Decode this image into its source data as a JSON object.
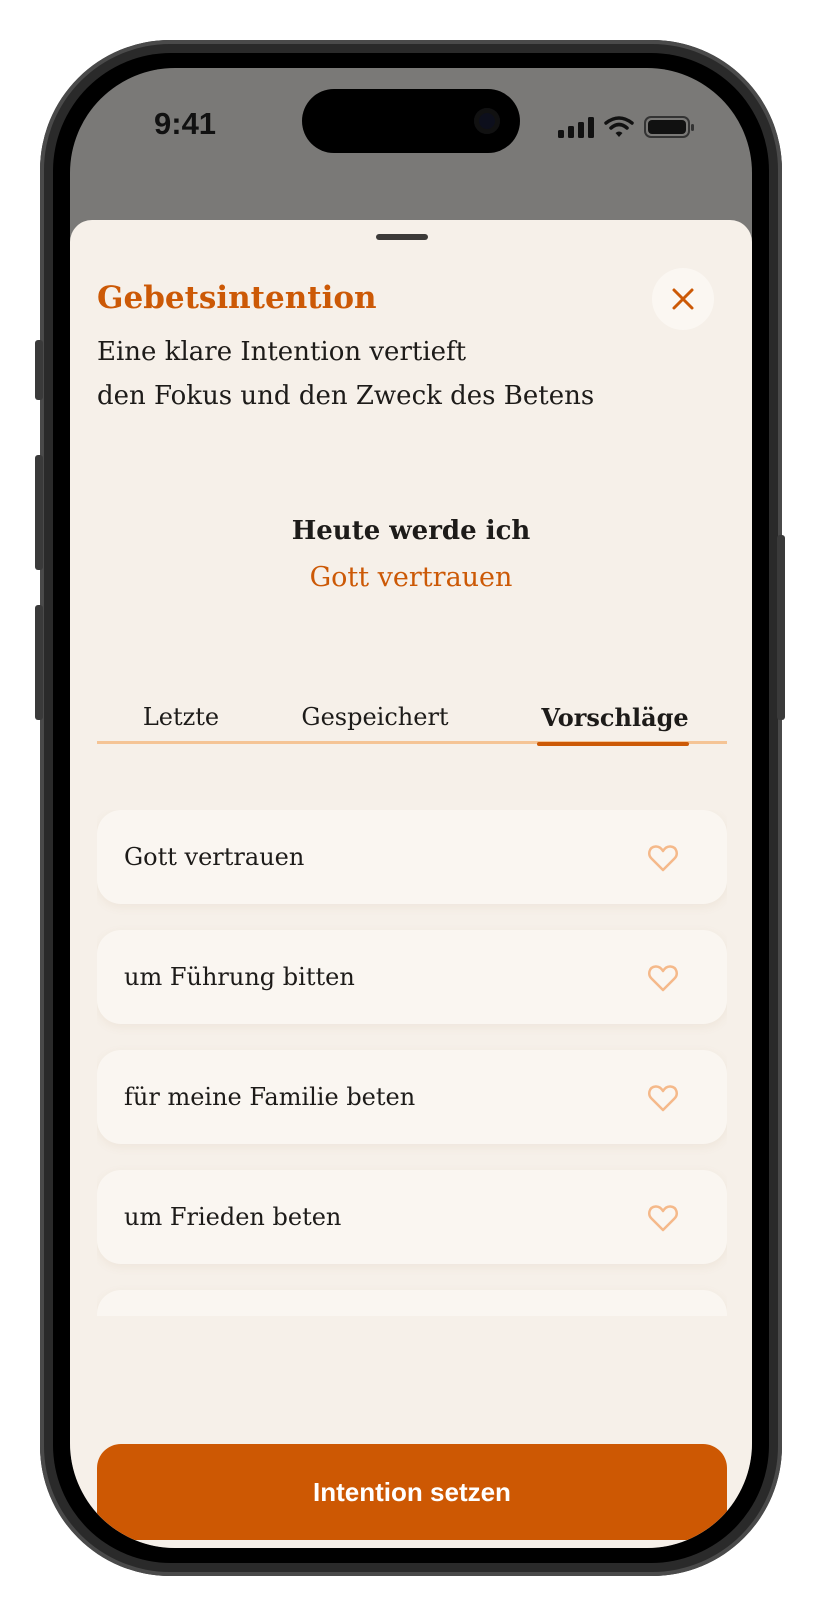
{
  "status_bar": {
    "time": "9:41",
    "icons": [
      "signal-icon",
      "wifi-icon",
      "battery-icon"
    ]
  },
  "sheet": {
    "title": "Gebetsintention",
    "subtitle_line1": "Eine klare Intention vertieft",
    "subtitle_line2": "den Fokus und den Zweck des Betens",
    "close_icon": "close-icon"
  },
  "intention": {
    "label": "Heute werde ich",
    "value": "Gott vertrauen"
  },
  "tabs": [
    {
      "label": "Letzte",
      "active": false
    },
    {
      "label": "Gespeichert",
      "active": false
    },
    {
      "label": "Vorschläge",
      "active": true
    }
  ],
  "suggestions": [
    {
      "label": "Gott vertrauen",
      "icon": "heart-icon",
      "saved": false
    },
    {
      "label": "um Führung bitten",
      "icon": "heart-icon",
      "saved": false
    },
    {
      "label": "für meine Familie beten",
      "icon": "heart-icon",
      "saved": false
    },
    {
      "label": "um Frieden beten",
      "icon": "heart-icon",
      "saved": false
    }
  ],
  "primary_button": {
    "label": "Intention setzen"
  },
  "colors": {
    "accent": "#cc5906",
    "sheet_background": "#f6f0e9",
    "card_background": "#faf6f1",
    "heart_outline": "#f5b98a",
    "tab_track": "#f5c495"
  }
}
